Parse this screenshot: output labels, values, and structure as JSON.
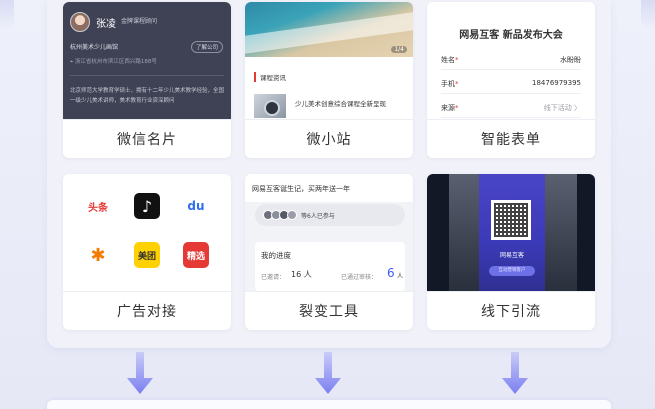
{
  "cards": [
    {
      "caption": "微信名片",
      "business_card": {
        "name": "张凌",
        "title": "金牌课程顾问",
        "org": "杭州美术少儿画馆",
        "tag": "了解公司",
        "address": "浙江省杭州市滨江区西兴路188号",
        "desc": "北京师范大学教育学硕士，拥有十二年少儿美术教学经验，全国一级少儿美术讲师，美术教育行业资深顾问"
      }
    },
    {
      "caption": "微小站",
      "mini_site": {
        "page_indicator": "1/4",
        "section_label": "课程资讯",
        "article_title": "少儿美术创意综合课程全新呈现"
      }
    },
    {
      "caption": "智能表单",
      "form": {
        "title": "网易互客 新品发布大会",
        "rows": [
          {
            "key": "姓名",
            "value": "水盼盼",
            "muted": false
          },
          {
            "key": "手机",
            "value": "18476979395",
            "muted": false
          },
          {
            "key": "来源",
            "value": "线下活动  〉",
            "muted": true
          }
        ]
      }
    },
    {
      "caption": "广告对接",
      "ads": [
        {
          "name": "头条",
          "bg": "#ffffff",
          "color": "#e53935"
        },
        {
          "name": "抖音",
          "bg": "#111111",
          "color": "#ffffff"
        },
        {
          "name": "百度",
          "bg": "#ffffff",
          "color": "#2f6ef0"
        },
        {
          "name": "饿了么",
          "bg": "#ffffff",
          "color": "#f57c00"
        },
        {
          "name": "美团",
          "bg": "#ffd100",
          "color": "#333333"
        },
        {
          "name": "精选",
          "bg": "#e53935",
          "color": "#ffffff"
        }
      ]
    },
    {
      "caption": "裂变工具",
      "fission": {
        "headline": "网易互客诞生记，买两年送一年",
        "joined_text": "等6人已参与",
        "progress_title": "我的进度",
        "invited_label": "已邀请：",
        "invited_count": "16 人",
        "verified_label": "已通过审核：",
        "verified_count": "6",
        "verified_unit": "人"
      }
    },
    {
      "caption": "线下引流",
      "offline": {
        "poster_title": "网易互客",
        "poster_button": "互动营销客户"
      }
    }
  ],
  "colors": {
    "arrow": "#7b7ff0",
    "accent": "#3d5afe",
    "required": "#e53935"
  }
}
